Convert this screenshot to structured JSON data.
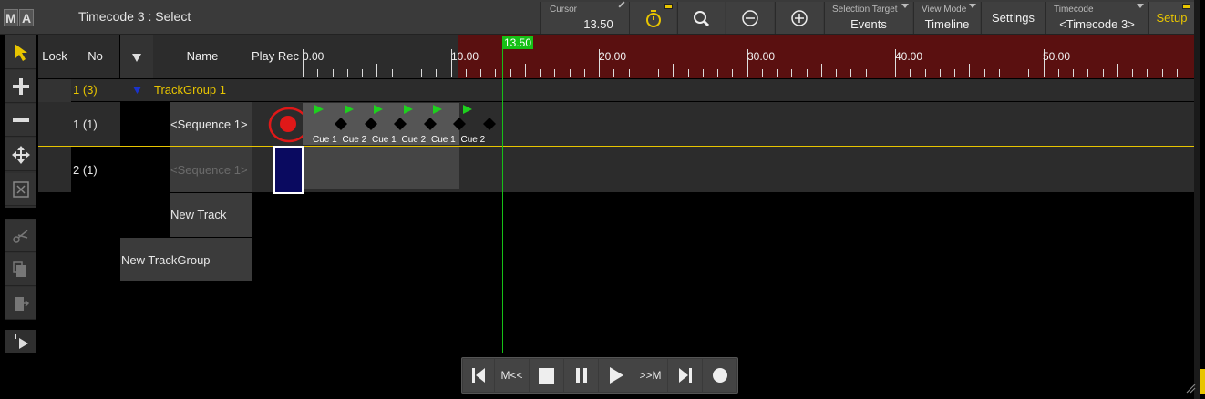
{
  "app": {
    "logo": [
      "M",
      "A"
    ],
    "title": "Timecode 3 : Select"
  },
  "titlebar": {
    "cursor": {
      "label": "Cursor",
      "value": "13.50"
    },
    "stopwatch_icon": "stopwatch-icon",
    "search_icon": "search-icon",
    "zoom_out_icon": "zoom-out-icon",
    "zoom_in_icon": "zoom-in-icon",
    "selection_target": {
      "label": "Selection Target",
      "value": "Events"
    },
    "view_mode": {
      "label": "View Mode",
      "value": "Timeline"
    },
    "settings": "Settings",
    "timecode": {
      "label": "Timecode",
      "value": "<Timecode 3>"
    },
    "setup": "Setup"
  },
  "columns": {
    "lock": "Lock",
    "no": "No",
    "sort_icon": "triangle-down-icon",
    "name": "Name",
    "playrec": "Play Rec"
  },
  "ruler": {
    "labels": [
      "0.00",
      "10.00",
      "20.00",
      "30.00",
      "40.00",
      "50.00"
    ],
    "cursor_value": "13.50",
    "cursor_pos": 13.5,
    "range_start": 0,
    "range_end": 59,
    "recorded_until": 10.6
  },
  "rows": [
    {
      "no": "1 (3)",
      "name": "TrackGroup 1",
      "type": "group"
    },
    {
      "no": "1 (1)",
      "name": "<Sequence 1>",
      "type": "track"
    },
    {
      "no": "2 (1)",
      "name": "<Sequence 1>",
      "type": "track-disabled"
    }
  ],
  "new_track": "New Track",
  "new_trackgroup": "New TrackGroup",
  "cues": [
    "Cue 1",
    "Cue 2",
    "Cue 1",
    "Cue 2",
    "Cue 1",
    "Cue 2"
  ],
  "cue_labels_visible": [
    "Cue 1",
    "Cue 2",
    "Cue 1",
    "Cue 2",
    "Cue 1",
    "Cue 2"
  ],
  "transport": {
    "prev_icon": "skip-back-icon",
    "fast_rewind": "M<<",
    "stop_icon": "stop-icon",
    "pause_icon": "pause-icon",
    "play_icon": "play-icon",
    "fast_forward": ">>M",
    "next_icon": "skip-forward-icon",
    "record_icon": "record-icon"
  },
  "colors": {
    "accent_yellow": "#e8c500",
    "cursor_green": "#16c016",
    "record_red": "#e01818",
    "ruler_red": "#5a1010",
    "selection_blue": "#0a0a60"
  }
}
